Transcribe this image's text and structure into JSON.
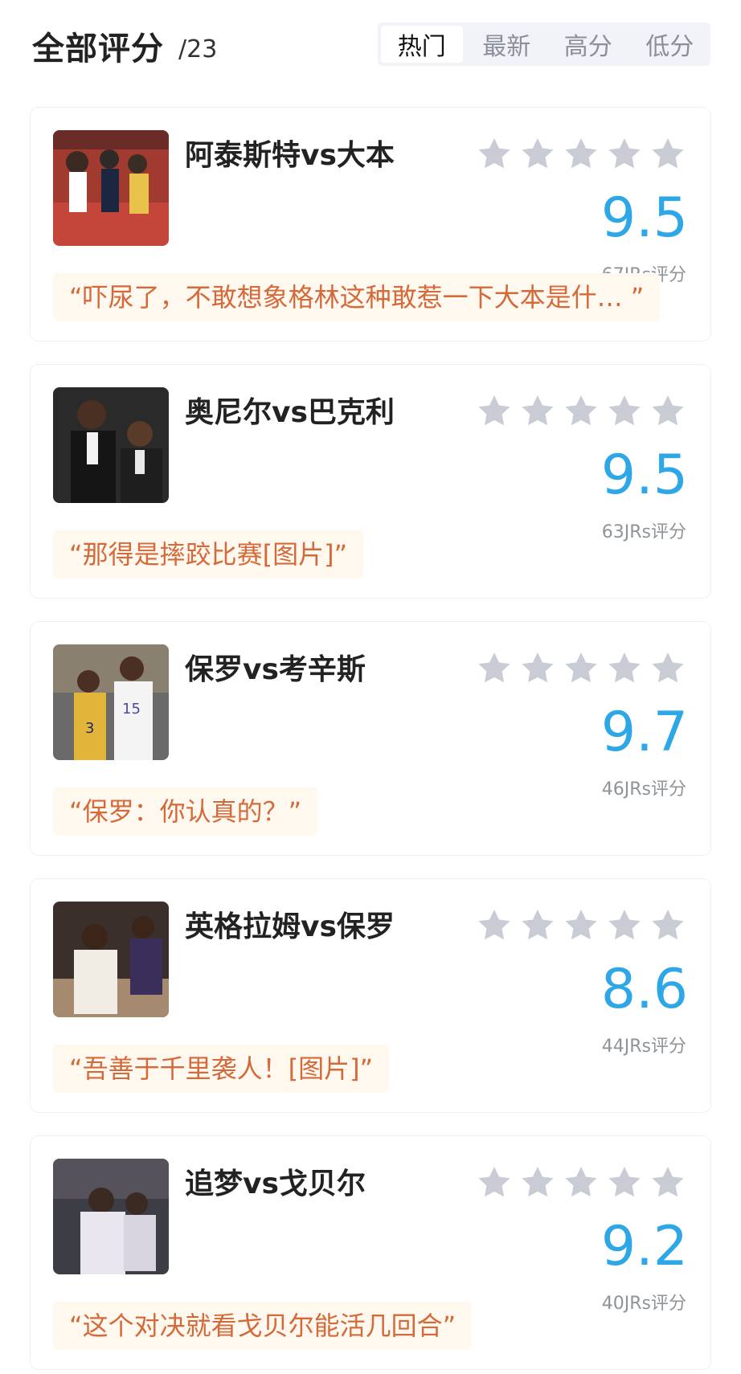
{
  "header": {
    "title": "全部评分",
    "count": "/23",
    "tabs": [
      {
        "label": "热门",
        "active": true
      },
      {
        "label": "最新",
        "active": false
      },
      {
        "label": "高分",
        "active": false
      },
      {
        "label": "低分",
        "active": false
      }
    ]
  },
  "colors": {
    "score": "#2ea7e6",
    "quote_text": "#d46a3a",
    "quote_bg": "#fff8ef",
    "star": "#c9ccd4"
  },
  "items": [
    {
      "title": "阿泰斯特vs大本",
      "score": "9.5",
      "raters": "67JRs评分",
      "quote": "“吓尿了，不敢想象格林这种敢惹一下大本是什…   ”",
      "stars_icon": "star-icon"
    },
    {
      "title": "奥尼尔vs巴克利",
      "score": "9.5",
      "raters": "63JRs评分",
      "quote": "“那得是摔跤比赛[图片]”",
      "stars_icon": "star-icon"
    },
    {
      "title": "保罗vs考辛斯",
      "score": "9.7",
      "raters": "46JRs评分",
      "quote": "“保罗：你认真的？”",
      "stars_icon": "star-icon"
    },
    {
      "title": "英格拉姆vs保罗",
      "score": "8.6",
      "raters": "44JRs评分",
      "quote": "“吾善于千里袭人！[图片]”",
      "stars_icon": "star-icon"
    },
    {
      "title": "追梦vs戈贝尔",
      "score": "9.2",
      "raters": "40JRs评分",
      "quote": "“这个对决就看戈贝尔能活几回合”",
      "stars_icon": "star-icon"
    }
  ]
}
